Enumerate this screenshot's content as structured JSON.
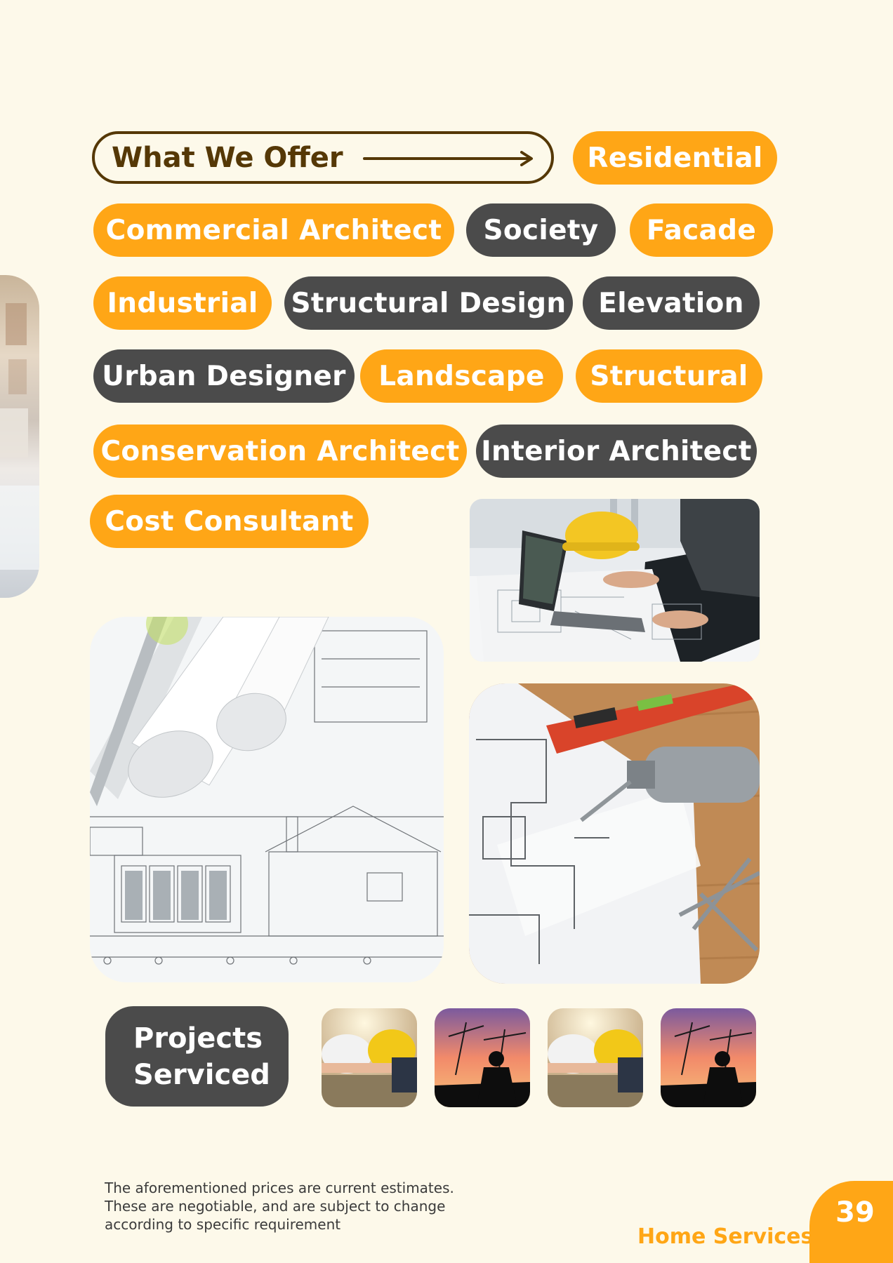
{
  "header": {
    "offer_label": "What We Offer"
  },
  "services": [
    {
      "label": "Residential",
      "style": "orange"
    },
    {
      "label": "Commercial Architect",
      "style": "orange"
    },
    {
      "label": "Society",
      "style": "dark"
    },
    {
      "label": "Facade",
      "style": "orange"
    },
    {
      "label": "Industrial",
      "style": "orange"
    },
    {
      "label": "Structural Design",
      "style": "dark"
    },
    {
      "label": "Elevation",
      "style": "dark"
    },
    {
      "label": "Urban Designer",
      "style": "dark"
    },
    {
      "label": "Landscape",
      "style": "orange"
    },
    {
      "label": "Structural",
      "style": "orange"
    },
    {
      "label": "Conservation Architect",
      "style": "orange"
    },
    {
      "label": "Interior Architect",
      "style": "dark"
    },
    {
      "label": "Cost Consultant",
      "style": "orange"
    }
  ],
  "projects": {
    "line1": "Projects",
    "line2": "Serviced"
  },
  "disclaimer": {
    "line1": "The aforementioned prices are current estimates.",
    "line2": "These are negotiable, and are subject to change",
    "line3": "according to specific requirement"
  },
  "footer": {
    "brand": "Home Services",
    "page_number": "39"
  },
  "colors": {
    "background": "#fdf9ea",
    "accent": "#ffa616",
    "dark_pill": "#4b4b4b",
    "outline_brown": "#553806"
  }
}
